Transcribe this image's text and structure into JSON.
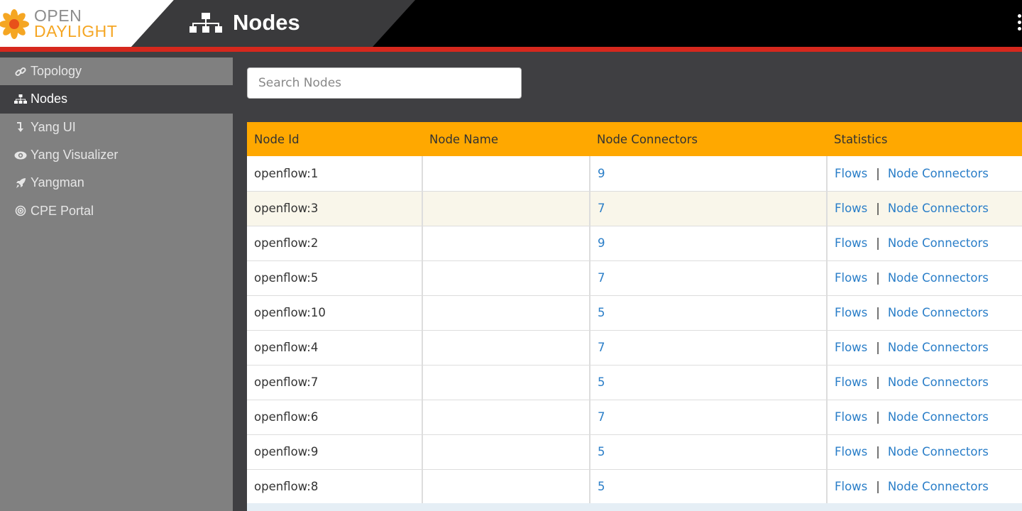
{
  "brand": {
    "line1": "OPEN",
    "line2": "DAYLIGHT"
  },
  "header": {
    "title": "Nodes"
  },
  "sidebar": {
    "items": [
      {
        "label": "Topology",
        "icon": "link-icon",
        "active": false
      },
      {
        "label": "Nodes",
        "icon": "sitemap-icon",
        "active": true
      },
      {
        "label": "Yang UI",
        "icon": "level-down-icon",
        "active": false
      },
      {
        "label": "Yang Visualizer",
        "icon": "eye-icon",
        "active": false
      },
      {
        "label": "Yangman",
        "icon": "rocket-icon",
        "active": false
      },
      {
        "label": "CPE Portal",
        "icon": "target-icon",
        "active": false
      }
    ]
  },
  "search": {
    "placeholder": "Search Nodes",
    "value": ""
  },
  "table": {
    "headers": [
      "Node Id",
      "Node Name",
      "Node Connectors",
      "Statistics"
    ],
    "flows_label": "Flows",
    "separator": "|",
    "connectors_label": "Node Connectors",
    "rows": [
      {
        "id": "openflow:1",
        "name": "",
        "connectors": "9"
      },
      {
        "id": "openflow:3",
        "name": "",
        "connectors": "7"
      },
      {
        "id": "openflow:2",
        "name": "",
        "connectors": "9"
      },
      {
        "id": "openflow:5",
        "name": "",
        "connectors": "7"
      },
      {
        "id": "openflow:10",
        "name": "",
        "connectors": "5"
      },
      {
        "id": "openflow:4",
        "name": "",
        "connectors": "7"
      },
      {
        "id": "openflow:7",
        "name": "",
        "connectors": "5"
      },
      {
        "id": "openflow:6",
        "name": "",
        "connectors": "7"
      },
      {
        "id": "openflow:9",
        "name": "",
        "connectors": "5"
      },
      {
        "id": "openflow:8",
        "name": "",
        "connectors": "5"
      }
    ]
  },
  "colors": {
    "accent": "#ffa800",
    "header_bg": "#000000",
    "red_bar": "#d6281d",
    "link": "#2a7ec8",
    "sidebar_bg": "#808080",
    "active_bg": "#3f3f42",
    "logo_orange": "#f5a623"
  }
}
